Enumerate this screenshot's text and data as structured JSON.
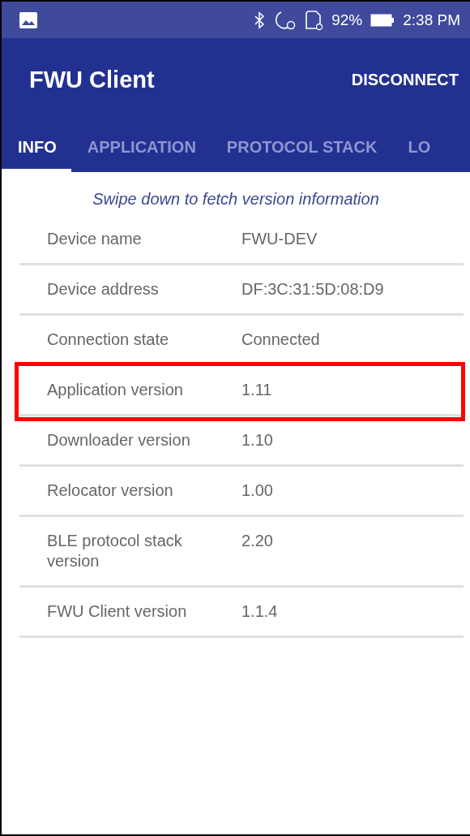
{
  "status_bar": {
    "battery": "92%",
    "time": "2:38 PM"
  },
  "app_bar": {
    "title": "FWU Client",
    "action": "DISCONNECT"
  },
  "tabs": [
    {
      "label": "INFO",
      "selected": true
    },
    {
      "label": "APPLICATION",
      "selected": false
    },
    {
      "label": "PROTOCOL STACK",
      "selected": false
    },
    {
      "label": "LO",
      "selected": false
    }
  ],
  "hint": "Swipe down to fetch version information",
  "rows": [
    {
      "label": "Device name",
      "value": "FWU-DEV",
      "highlighted": false
    },
    {
      "label": "Device address",
      "value": "DF:3C:31:5D:08:D9",
      "highlighted": false
    },
    {
      "label": "Connection state",
      "value": "Connected",
      "highlighted": false
    },
    {
      "label": "Application version",
      "value": "1.11",
      "highlighted": true
    },
    {
      "label": "Downloader version",
      "value": "1.10",
      "highlighted": false
    },
    {
      "label": "Relocator version",
      "value": "1.00",
      "highlighted": false
    },
    {
      "label": "BLE protocol stack version",
      "value": "2.20",
      "highlighted": false
    },
    {
      "label": "FWU Client version",
      "value": "1.1.4",
      "highlighted": false
    }
  ]
}
